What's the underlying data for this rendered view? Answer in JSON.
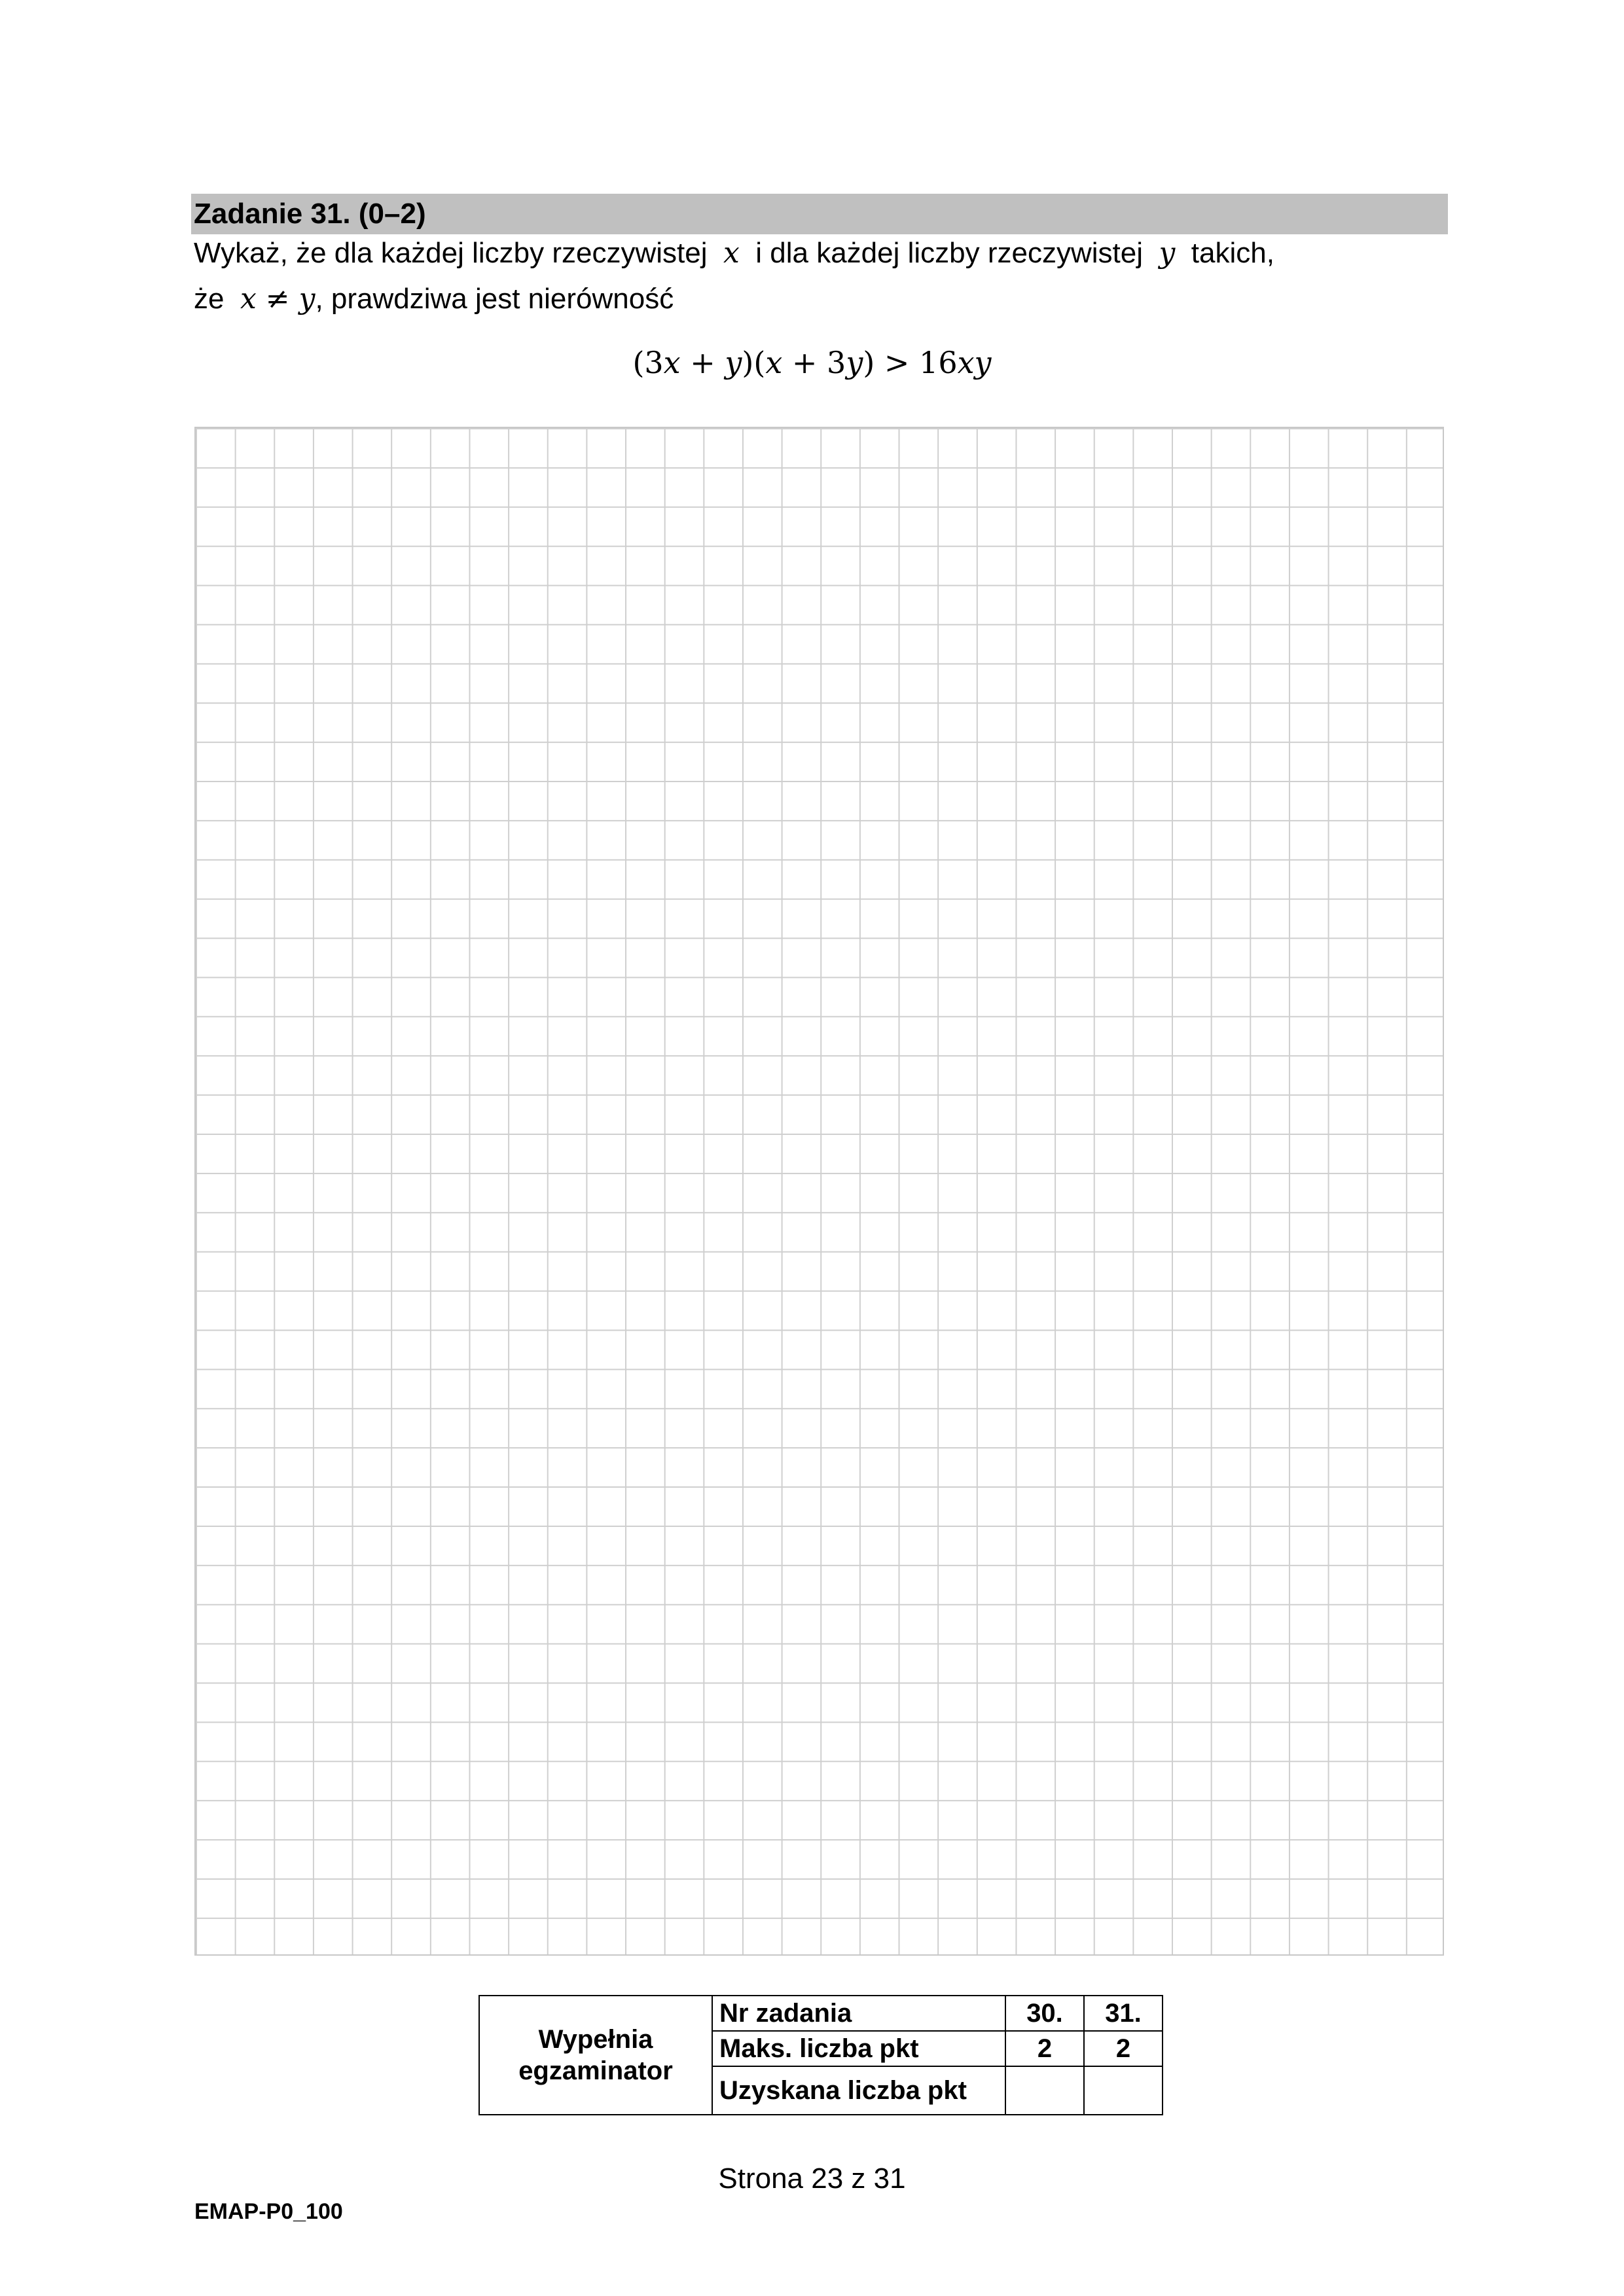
{
  "task": {
    "title": "Zadanie 31. (0–2)",
    "line1_a": "Wykaż, że dla każdej liczby rzeczywistej",
    "var_x": "x",
    "line1_b": "i dla każdej liczby rzeczywistej",
    "var_y": "y",
    "line1_c": "takich,",
    "line2_a": "że",
    "condition": "x ≠ y",
    "line2_b": ", prawdziwa jest nierówność",
    "formula": {
      "p1": "(3",
      "v1": "x",
      "p2": " + ",
      "v2": "y",
      "p3": ")(",
      "v3": "x",
      "p4": " + 3",
      "v4": "y",
      "p5": ") > 16",
      "v5": "xy"
    }
  },
  "score_table": {
    "filled_by": "Wypełnia egzaminator",
    "row_task_number": "Nr zadania",
    "task_numbers": [
      "30.",
      "31."
    ],
    "row_max_points": "Maks. liczba pkt",
    "max_points": [
      "2",
      "2"
    ],
    "row_obtained_points": "Uzyskana liczba pkt",
    "obtained_points": [
      "",
      ""
    ]
  },
  "footer": {
    "page_number": "Strona 23 z 31",
    "code": "EMAP-P0_100"
  }
}
